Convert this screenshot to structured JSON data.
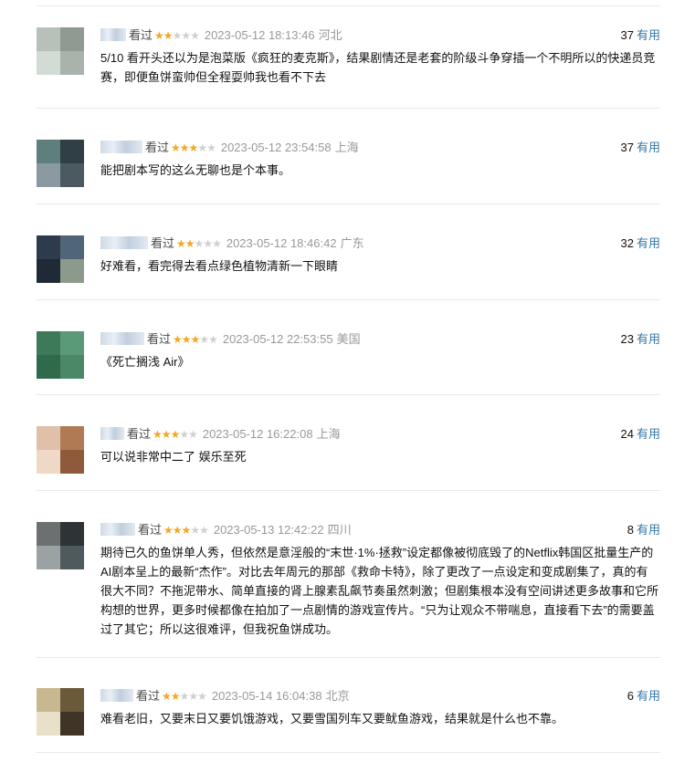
{
  "reviews": [
    {
      "watched": "看过",
      "stars": 2,
      "time": "2023-05-12 18:13:46",
      "location": "河北",
      "votes": "37",
      "useful_label": "有用",
      "content": "5/10 看开头还以为是泡菜版《疯狂的麦克斯》，结果剧情还是老套的阶级斗争穿插一个不明所以的快递员竞赛，即便鱼饼蛮帅但全程耍帅我也看不下去",
      "avatar_colors": [
        "#b7c1b9",
        "#8e9a92",
        "#d3dbd5",
        "#a9b3ab"
      ]
    },
    {
      "watched": "看过",
      "stars": 3,
      "time": "2023-05-12 23:54:58",
      "location": "上海",
      "votes": "37",
      "useful_label": "有用",
      "content": "能把剧本写的这么无聊也是个本事。",
      "avatar_colors": [
        "#5f7f7d",
        "#2f3f45",
        "#8a9aa0",
        "#4a5a60"
      ]
    },
    {
      "watched": "看过",
      "stars": 2,
      "time": "2023-05-12 18:46:42",
      "location": "广东",
      "votes": "32",
      "useful_label": "有用",
      "content": "好难看，看完得去看点绿色植物清新一下眼睛",
      "avatar_colors": [
        "#2e3b4c",
        "#516578",
        "#1f2a36",
        "#8b9a8a"
      ]
    },
    {
      "watched": "看过",
      "stars": 3,
      "time": "2023-05-12 22:53:55",
      "location": "美国",
      "votes": "23",
      "useful_label": "有用",
      "content": "《死亡搁浅 Air》",
      "avatar_colors": [
        "#3d7a5a",
        "#5a9a78",
        "#2f6a4c",
        "#4b8868"
      ]
    },
    {
      "watched": "看过",
      "stars": 3,
      "time": "2023-05-12 16:22:08",
      "location": "上海",
      "votes": "24",
      "useful_label": "有用",
      "content": "可以说非常中二了 娱乐至死",
      "avatar_colors": [
        "#e0c0a8",
        "#b07a55",
        "#f0d8c6",
        "#8f5a3c"
      ]
    },
    {
      "watched": "看过",
      "stars": 3,
      "time": "2023-05-13 12:42:22",
      "location": "四川",
      "votes": "8",
      "useful_label": "有用",
      "content": "期待已久的鱼饼单人秀，但依然是意淫般的“末世·1%·拯救”设定都像被彻底毁了的Netflix韩国区批量生产的AI剧本呈上的最新“杰作”。对比去年周元的那部《救命卡特》，除了更改了一点设定和变成剧集了，真的有很大不同？不拖泥带水、简单直接的肾上腺素乱飙节奏虽然刺激；但剧集根本没有空间讲述更多故事和它所构想的世界，更多时候都像在拍加了一点剧情的游戏宣传片。“只为让观众不带喘息，直接看下去”的需要盖过了其它；所以这很难评，但我祝鱼饼成功。",
      "avatar_colors": [
        "#6c7070",
        "#2e3436",
        "#9aa2a4",
        "#4f5a5e"
      ]
    },
    {
      "watched": "看过",
      "stars": 2,
      "time": "2023-05-14 16:04:38",
      "location": "北京",
      "votes": "6",
      "useful_label": "有用",
      "content": "难看老旧，又要末日又要饥饿游戏，又要雪国列车又要鱿鱼游戏，结果就是什么也不靠。",
      "avatar_colors": [
        "#c8b890",
        "#6a5a3a",
        "#e8e0c8",
        "#3f3426"
      ]
    }
  ]
}
